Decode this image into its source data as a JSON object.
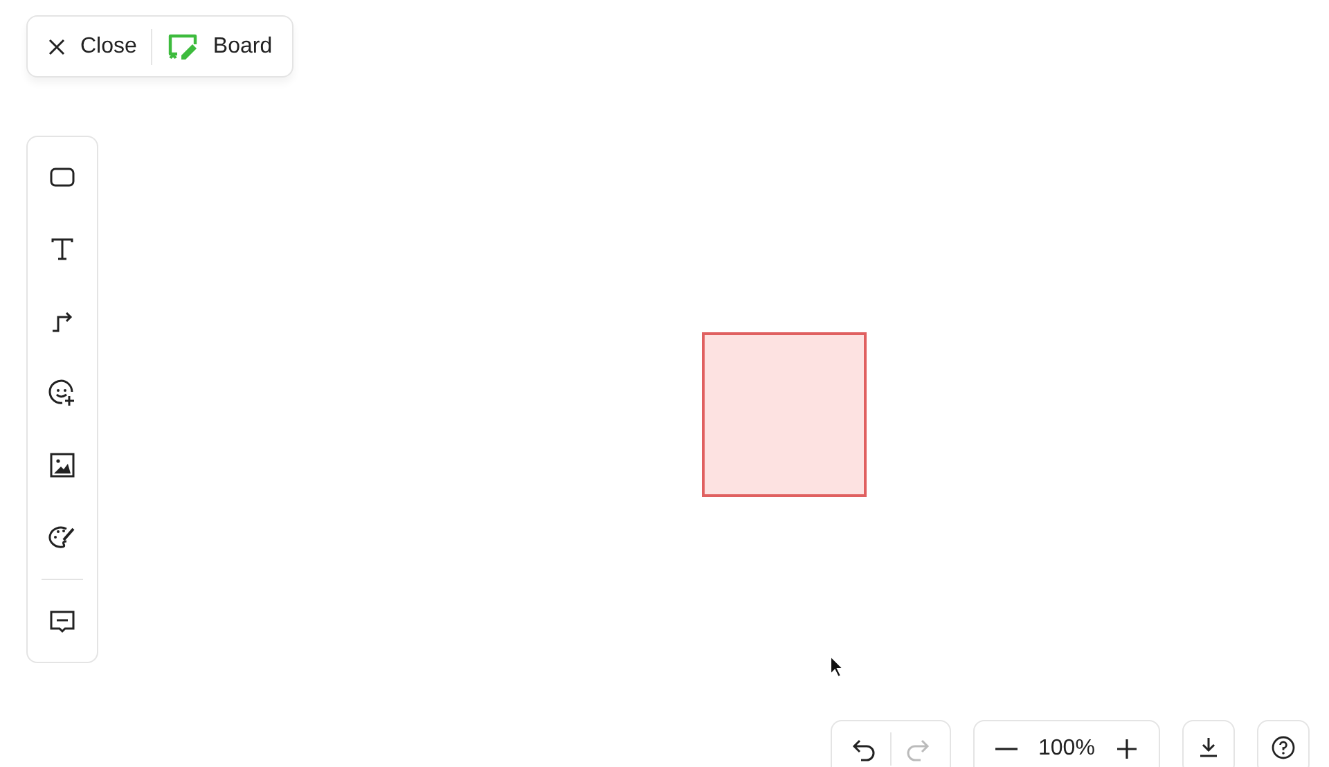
{
  "header": {
    "close_label": "Close",
    "board_label": "Board"
  },
  "tools": [
    {
      "kind": "rectangle"
    },
    {
      "kind": "text"
    },
    {
      "kind": "connector"
    },
    {
      "kind": "sticker"
    },
    {
      "kind": "image"
    },
    {
      "kind": "palette"
    },
    {
      "kind": "divider"
    },
    {
      "kind": "comment"
    }
  ],
  "canvas": {
    "shapes": [
      {
        "kind": "rectangle",
        "color": "#fde2e1"
      }
    ]
  },
  "history": {
    "undo_disabled": false,
    "redo_disabled": true
  },
  "zoom": {
    "value": "100%"
  }
}
